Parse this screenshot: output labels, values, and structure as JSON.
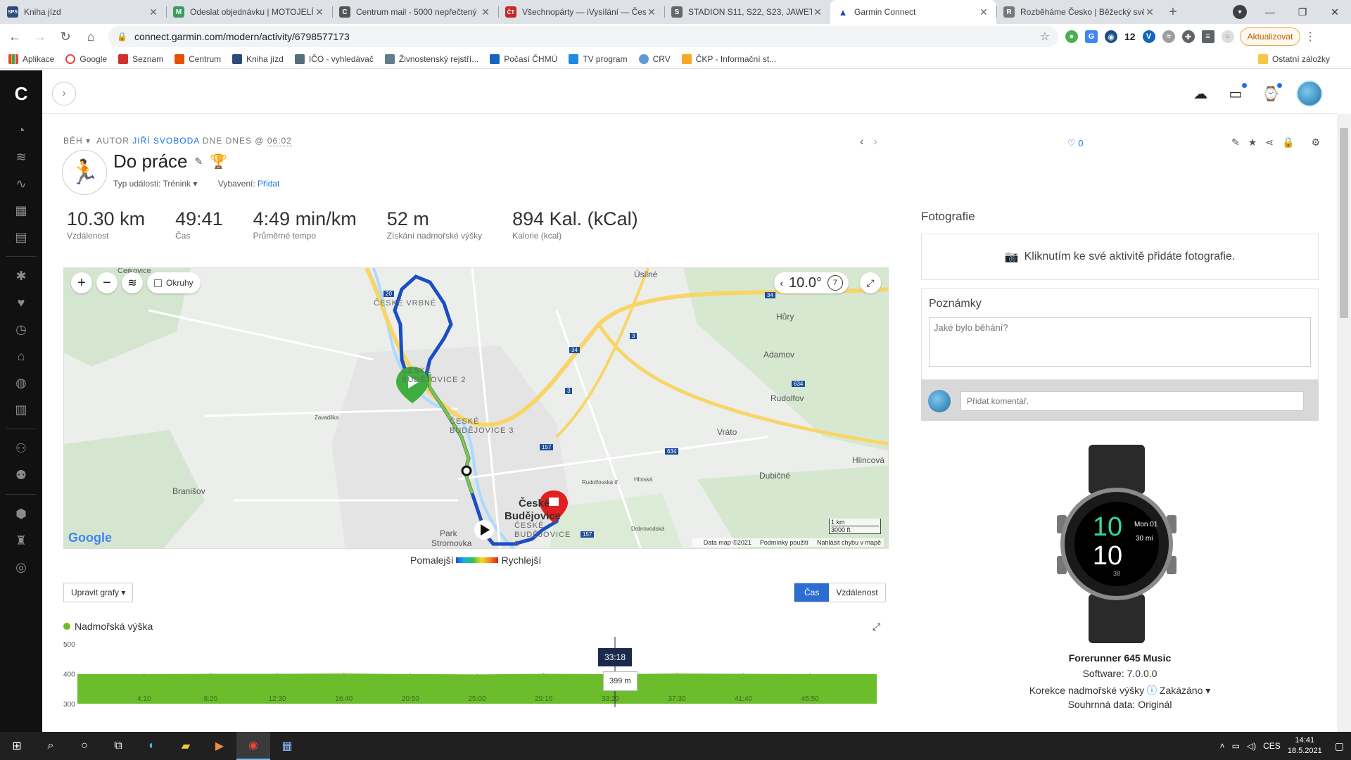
{
  "browser": {
    "tabs": [
      {
        "title": "Kniha jízd",
        "fav_color": "#2d4a7a",
        "fav_text": "SPS"
      },
      {
        "title": "Odeslat objednávku | MOTOJELÍ",
        "fav_color": "#3a9d5d",
        "fav_text": "M"
      },
      {
        "title": "Centrum mail - 5000 nepřečtený",
        "fav_color": "#555",
        "fav_text": "C"
      },
      {
        "title": "Všechnopárty — iVysílání — Čes",
        "fav_color": "#c62828",
        "fav_text": "ČT"
      },
      {
        "title": "STADION S11, S22, S23, JAWETA",
        "fav_color": "#666",
        "fav_text": "S"
      },
      {
        "title": "Garmin Connect",
        "fav_color": "#1b4f9c",
        "fav_text": "▲"
      },
      {
        "title": "Rozběháme Česko | Běžecký svě",
        "fav_color": "#777",
        "fav_text": "R"
      }
    ],
    "active_tab": 5,
    "url": "connect.garmin.com/modern/activity/6798577173",
    "ext_count": "12",
    "update_label": "Aktualizovat",
    "bookmarks": [
      {
        "label": "Aplikace",
        "color": "#4285f4"
      },
      {
        "label": "Google",
        "color": "#ea4335"
      },
      {
        "label": "Seznam",
        "color": "#d32f2f"
      },
      {
        "label": "Centrum",
        "color": "#e65100"
      },
      {
        "label": "Kniha jízd",
        "color": "#2d4a7a"
      },
      {
        "label": "IČO - vyhledávač",
        "color": "#546e7a"
      },
      {
        "label": "Živnostenský rejstří...",
        "color": "#607d8b"
      },
      {
        "label": "Počasí ČHMÚ",
        "color": "#1565c0"
      },
      {
        "label": "TV program",
        "color": "#1e88e5"
      },
      {
        "label": "CRV",
        "color": "#5c9bd6"
      },
      {
        "label": "ČKP - Informační st...",
        "color": "#f9a825"
      }
    ],
    "other_bookmarks": "Ostatní záložky"
  },
  "activity": {
    "type_label": "BĚH",
    "author_prefix": "AUTOR",
    "author": "JIŘÍ SVOBODA",
    "date_prefix": "DNE",
    "date": "DNES @",
    "time": "06:02",
    "title": "Do práce",
    "event_type": "Typ události: Trénink ▾",
    "gear_label": "Vybavení:",
    "gear_action": "Přidat",
    "likes": "0"
  },
  "stats": [
    {
      "value": "10.30 km",
      "label": "Vzdálenost"
    },
    {
      "value": "49:41",
      "label": "Čas"
    },
    {
      "value": "4:49 min/km",
      "label": "Průměrné tempo"
    },
    {
      "value": "52 m",
      "label": "Získání nadmořské výšky"
    },
    {
      "value": "894 Kal. (kCal)",
      "label": "Kalorie (kcal)"
    }
  ],
  "map": {
    "laps_label": "Okruhy",
    "temperature": "10.0°",
    "wind": "7",
    "labels": [
      "Cejkovice",
      "ČESKÉ VRBNÉ",
      "ČESKÉ BUDĚJOVICE 2",
      "ČESKÉ BUDĚJOVICE 3",
      "České",
      "Budějovice",
      "ČESKÉ BUDĚJOVICE 6",
      "Úsilné",
      "Hůry",
      "Adamov",
      "Rudolfov",
      "Vráto",
      "Hlincová",
      "Dubičné",
      "Branišov",
      "Park",
      "Stromovka",
      "Zavadilka",
      "Dobrovodská",
      "Hlinská",
      "Rudolfovská tř."
    ],
    "road_numbers": [
      "20",
      "34",
      "3",
      "34",
      "3",
      "157",
      "634",
      "634",
      "157"
    ],
    "scale_km": "1 km",
    "scale_ft": "3000 ft",
    "attribution": [
      "Data map ©2021",
      "Podmínky použití",
      "Nahlásit chybu v mapě"
    ],
    "google": "Google"
  },
  "pace_legend": {
    "slower": "Pomalejší",
    "faster": "Rychlejší"
  },
  "charts": {
    "edit_label": "Upravit grafy ▾",
    "toggle_time": "Čas",
    "toggle_distance": "Vzdálenost",
    "elevation_title": "Nadmořská výška",
    "crosshair_time": "33:18",
    "crosshair_value": "399 m"
  },
  "chart_data": {
    "type": "area",
    "title": "Nadmořská výška",
    "x": [
      "4:10",
      "8:20",
      "12:30",
      "16:40",
      "20:50",
      "25:00",
      "29:10",
      "33:20",
      "37:30",
      "41:40",
      "45:50"
    ],
    "y_ticks": [
      "500",
      "400",
      "300"
    ],
    "ylim": [
      300,
      500
    ],
    "series": [
      {
        "name": "Nadmořská výška",
        "values": [
          399,
          400,
          400,
          401,
          399,
          398,
          400,
          399,
          401,
          400,
          399
        ]
      }
    ],
    "color": "#6bbd2c",
    "grid": false
  },
  "right": {
    "photos_title": "Fotografie",
    "photos_prompt": "Kliknutím ke své aktivitě přidáte fotografie.",
    "notes_title": "Poznámky",
    "notes_placeholder": "Jaké bylo běhání?",
    "comment_placeholder": "Přidat komentář.",
    "watch_time_hours": "10",
    "watch_time_minutes": "10",
    "watch_date": "Mon 01",
    "watch_seconds": "38",
    "watch_run": "30 mi",
    "device_name": "Forerunner 645 Music",
    "software": "Software: 7.0.0.0",
    "elevation_correction_label": "Korekce nadmořské výšky",
    "elevation_correction_value": "Zakázáno ▾",
    "summary_data": "Souhrnná data: Originál"
  },
  "taskbar": {
    "lang": "CES",
    "time": "14:41",
    "date": "18.5.2021"
  }
}
